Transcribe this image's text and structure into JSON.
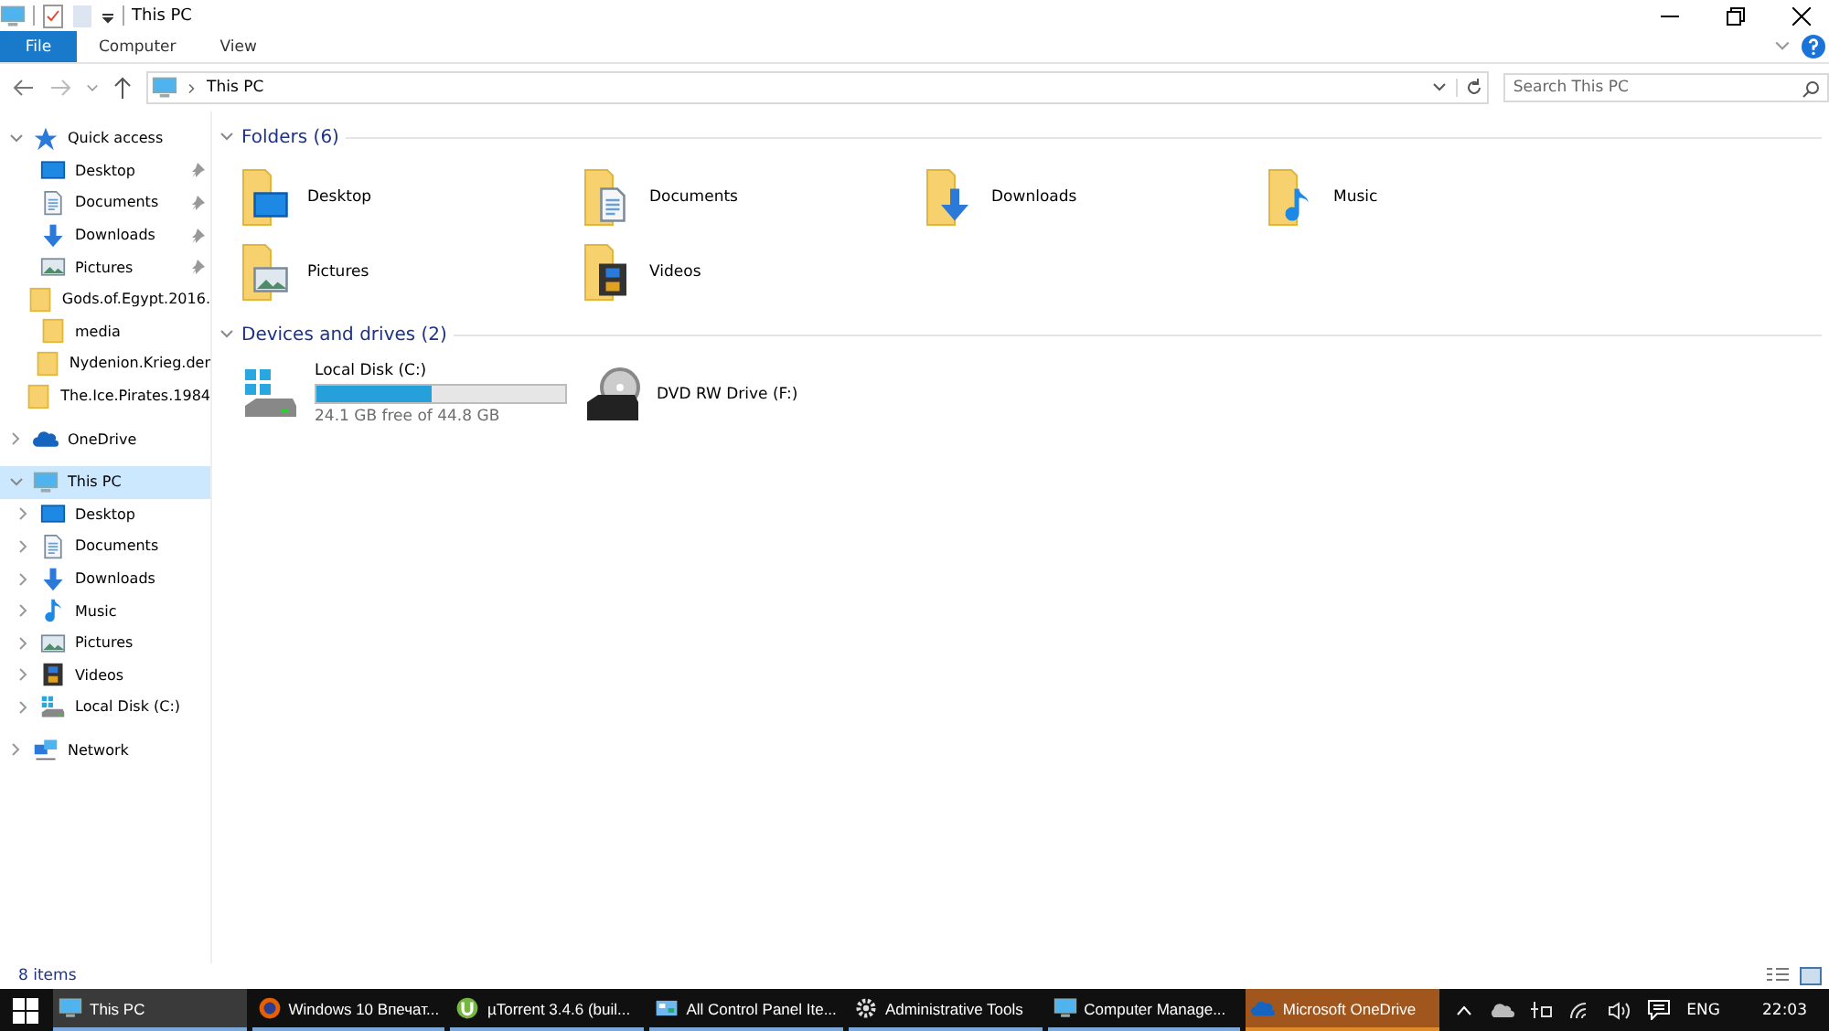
{
  "window": {
    "title": "This PC"
  },
  "ribbon": {
    "tabs": [
      {
        "label": "File",
        "selected": true
      },
      {
        "label": "Computer",
        "selected": false
      },
      {
        "label": "View",
        "selected": false
      }
    ]
  },
  "address": {
    "path": [
      "This PC"
    ]
  },
  "search": {
    "placeholder": "Search This PC"
  },
  "sidebar": {
    "items": [
      {
        "label": "Quick access",
        "kind": "star",
        "expanded": true,
        "selected": false,
        "children": [
          {
            "label": "Desktop",
            "kind": "desktop",
            "pinned": true,
            "selected": false
          },
          {
            "label": "Documents",
            "kind": "documents",
            "pinned": true,
            "selected": false
          },
          {
            "label": "Downloads",
            "kind": "downloads",
            "pinned": true,
            "selected": false
          },
          {
            "label": "Pictures",
            "kind": "pictures",
            "pinned": true,
            "selected": false
          },
          {
            "label": "Gods.of.Egypt.2016.",
            "kind": "folder",
            "pinned": false,
            "selected": false
          },
          {
            "label": "media",
            "kind": "folder",
            "pinned": false,
            "selected": false
          },
          {
            "label": "Nydenion.Krieg.der",
            "kind": "folder",
            "pinned": false,
            "selected": false
          },
          {
            "label": "The.Ice.Pirates.1984",
            "kind": "folder",
            "pinned": false,
            "selected": false
          }
        ]
      },
      {
        "label": "OneDrive",
        "kind": "cloud",
        "expanded": false,
        "selected": false
      },
      {
        "label": "This PC",
        "kind": "pc",
        "expanded": true,
        "selected": true,
        "children": [
          {
            "label": "Desktop",
            "kind": "desktop",
            "expanded": false,
            "selected": false
          },
          {
            "label": "Documents",
            "kind": "documents",
            "expanded": false,
            "selected": false
          },
          {
            "label": "Downloads",
            "kind": "downloads",
            "expanded": false,
            "selected": false
          },
          {
            "label": "Music",
            "kind": "music",
            "expanded": false,
            "selected": false
          },
          {
            "label": "Pictures",
            "kind": "pictures",
            "expanded": false,
            "selected": false
          },
          {
            "label": "Videos",
            "kind": "videos",
            "expanded": false,
            "selected": false
          },
          {
            "label": "Local Disk (C:)",
            "kind": "disk",
            "expanded": false,
            "selected": false
          }
        ]
      },
      {
        "label": "Network",
        "kind": "network",
        "expanded": false,
        "selected": false
      }
    ]
  },
  "sections": [
    {
      "title": "Folders (6)",
      "expanded": true,
      "items": [
        {
          "label": "Desktop",
          "kind": "desktop"
        },
        {
          "label": "Documents",
          "kind": "documents"
        },
        {
          "label": "Downloads",
          "kind": "downloads"
        },
        {
          "label": "Music",
          "kind": "music"
        },
        {
          "label": "Pictures",
          "kind": "pictures"
        },
        {
          "label": "Videos",
          "kind": "videos"
        }
      ]
    },
    {
      "title": "Devices and drives (2)",
      "expanded": true,
      "items": [
        {
          "label": "Local Disk (C:)",
          "kind": "disk",
          "level": 0.46,
          "detail": "24.1 GB free of 44.8 GB"
        },
        {
          "label": "DVD RW Drive (F:)",
          "kind": "dvd"
        }
      ]
    }
  ],
  "status_bar": {
    "text": "8 items"
  },
  "taskbar": {
    "items": [
      {
        "label": "This PC",
        "kind": "pc",
        "selected": true,
        "flashing": false
      },
      {
        "label": "Windows 10 Впечат...",
        "kind": "browser",
        "selected": false,
        "flashing": false
      },
      {
        "label": "µTorrent 3.4.6  (buil...",
        "kind": "torrent",
        "selected": false,
        "flashing": false
      },
      {
        "label": "All Control Panel Ite...",
        "kind": "panel",
        "selected": false,
        "flashing": false
      },
      {
        "label": "Administrative Tools",
        "kind": "gear",
        "selected": false,
        "flashing": false
      },
      {
        "label": "Computer Manage...",
        "kind": "pc",
        "selected": false,
        "flashing": false
      },
      {
        "label": "Microsoft OneDrive",
        "kind": "cloud",
        "selected": false,
        "flashing": true
      }
    ],
    "language": "ENG",
    "time": "22:03"
  }
}
